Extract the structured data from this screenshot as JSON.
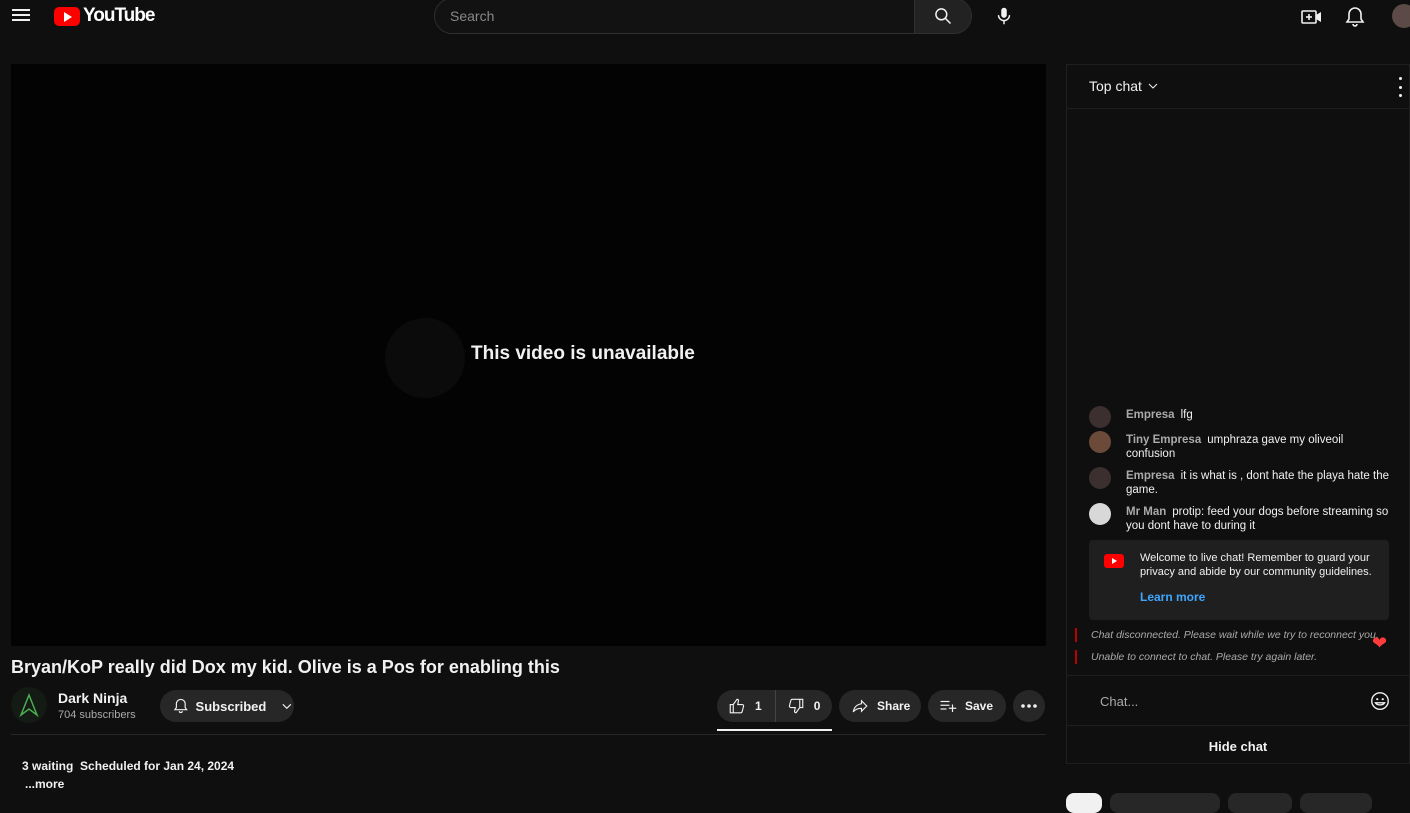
{
  "header": {
    "logo_text": "YouTube",
    "search_placeholder": "Search"
  },
  "player": {
    "unavailable_text": "This video is unavailable"
  },
  "video": {
    "title": "Bryan/KoP really did Dox my kid. Olive is a Pos for enabling this",
    "channel_name": "Dark Ninja",
    "subscribers": "704 subscribers",
    "subscribe_label": "Subscribed",
    "likes": "1",
    "dislikes": "0",
    "share_label": "Share",
    "save_label": "Save",
    "waiting": "3 waiting",
    "scheduled": "Scheduled for Jan 24, 2024",
    "more_label": "...more"
  },
  "chat": {
    "mode_label": "Top chat",
    "messages": [
      {
        "author": "Empresa",
        "text": "lfg"
      },
      {
        "author": "Tiny Empresa",
        "text": "umphraza gave my oliveoil confusion"
      },
      {
        "author": "Empresa",
        "text": "it is what is , dont hate the playa hate the game."
      },
      {
        "author": "Mr Man",
        "text": "protip: feed your dogs before streaming so you dont have to during it"
      }
    ],
    "welcome_text": "Welcome to live chat! Remember to guard your privacy and abide by our community guidelines.",
    "learn_more": "Learn more",
    "system_messages": [
      "Chat disconnected. Please wait while we try to reconnect you.",
      "Unable to connect to chat. Please try again later."
    ],
    "input_placeholder": "Chat...",
    "hide_chat_label": "Hide chat"
  },
  "icons": {
    "menu": "hamburger-icon",
    "search": "search-icon",
    "mic": "microphone-icon",
    "create": "create-video-icon",
    "notifications": "bell-icon",
    "like": "thumbs-up-icon",
    "dislike": "thumbs-down-icon",
    "share": "share-icon",
    "save": "add-to-playlist-icon",
    "more": "more-horizontal-icon",
    "emoji": "emoji-icon",
    "heart": "heart-icon"
  },
  "colors": {
    "brand_red": "#ff0000",
    "link_blue": "#3ea6ff",
    "background": "#0f0f0f"
  }
}
